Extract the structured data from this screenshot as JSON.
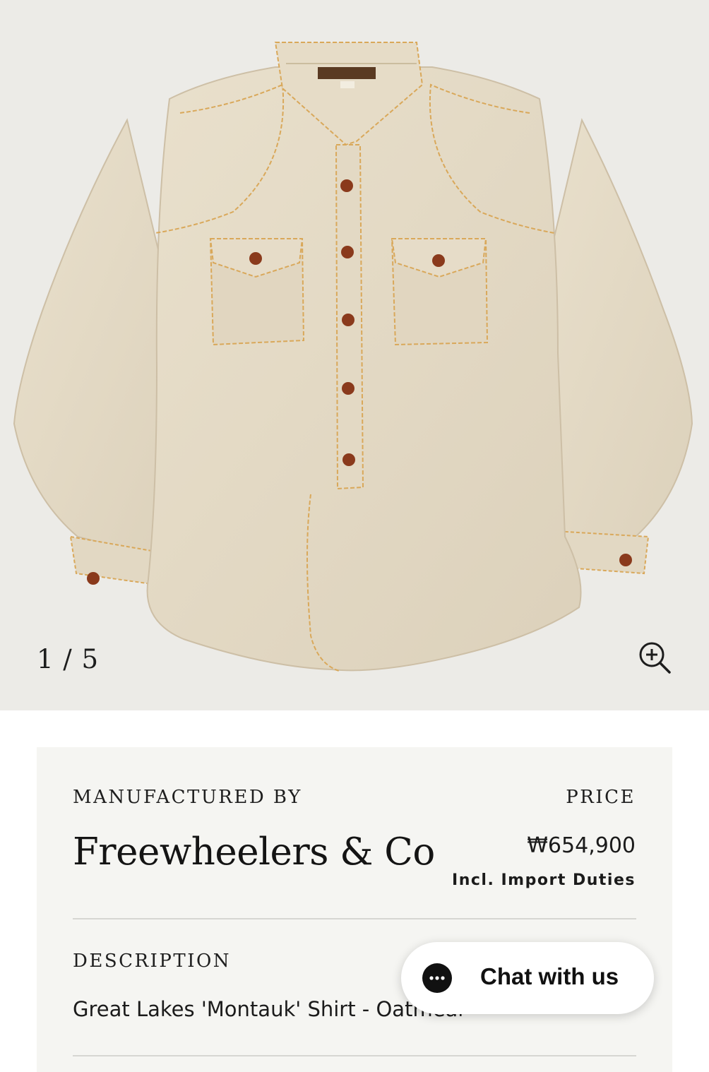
{
  "gallery": {
    "image_alt": "Great Lakes 'Montauk' Shirt - Oatmeal",
    "counter": "1 / 5",
    "zoom_icon": "zoom-in-icon"
  },
  "product": {
    "manufacturer_label": "MANUFACTURED BY",
    "manufacturer": "Freewheelers & Co",
    "price_label": "PRICE",
    "price": "₩654,900",
    "price_note": "Incl. Import Duties",
    "description_label": "DESCRIPTION",
    "description": "Great Lakes 'Montauk' Shirt - Oatmeal"
  },
  "chat": {
    "label": "Chat with us",
    "icon": "chat-bubble-icon"
  },
  "colors": {
    "background": "#ffffff",
    "gallery_bg": "#ecebe7",
    "card_bg": "#f5f5f2",
    "text": "#1b1b1b",
    "shirt": "#e4dac6",
    "stitch": "#d9a85a",
    "button": "#8a3a1c"
  }
}
